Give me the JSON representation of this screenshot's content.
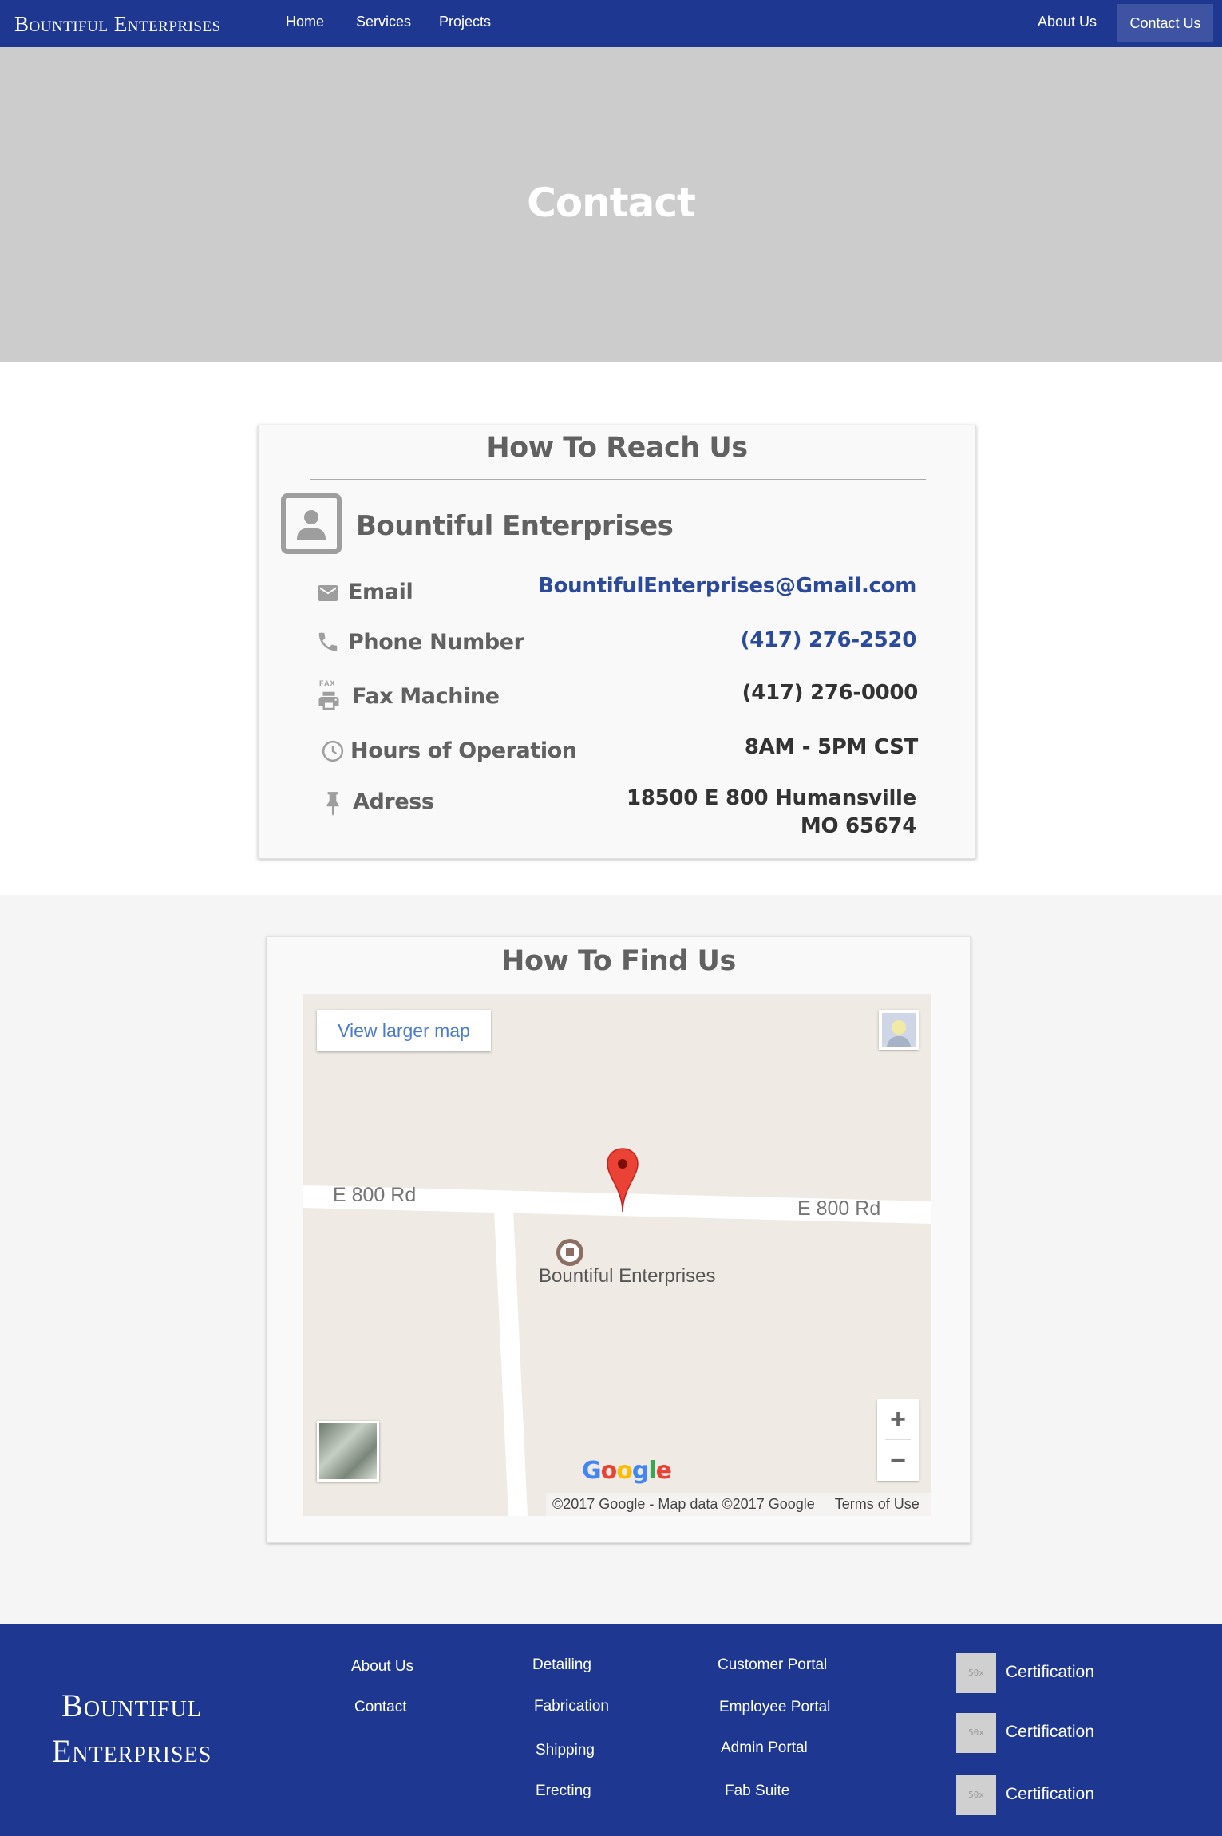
{
  "navbar": {
    "brand": "Bountiful Enterprises",
    "links": [
      "Home",
      "Services",
      "Projects"
    ],
    "about": "About Us",
    "contact": "Contact Us"
  },
  "hero": {
    "title": "Contact"
  },
  "reach": {
    "heading": "How To Reach Us",
    "company": "Bountiful Enterprises",
    "rows": [
      {
        "icon": "envelope-icon",
        "label": "Email",
        "value": "BountifulEnterprises@Gmail.com"
      },
      {
        "icon": "phone-icon",
        "label": "Phone Number",
        "value": "(417) 276-2520"
      },
      {
        "icon": "fax-icon",
        "label": "Fax Machine",
        "value": "(417) 276-0000"
      },
      {
        "icon": "clock-icon",
        "label": "Hours of Operation",
        "value": "8AM - 5PM CST"
      },
      {
        "icon": "pin-icon",
        "label": "Adress",
        "value_line1": "18500 E 800 Humansville",
        "value_line2": "MO 65674"
      }
    ],
    "fax_icon_text": "FAX"
  },
  "find": {
    "heading": "How To Find Us",
    "map": {
      "view_larger": "View larger map",
      "road_left": "E 800 Rd",
      "road_right": "E 800 Rd",
      "place": "Bountiful Enterprises",
      "zoom_in": "+",
      "zoom_out": "−",
      "google_letters": [
        "G",
        "o",
        "o",
        "g",
        "l",
        "e"
      ],
      "google_colors": [
        "#4285f4",
        "#ea4335",
        "#fbbc05",
        "#4285f4",
        "#34a853",
        "#ea4335"
      ],
      "copyright": "©2017 Google - Map data ©2017 Google",
      "terms": "Terms of Use"
    }
  },
  "footer": {
    "brand_line1": "Bountiful",
    "brand_line2": "Enterprises",
    "col1": [
      "About Us",
      "Contact"
    ],
    "col2": [
      "Detailing",
      "Fabrication",
      "Shipping",
      "Erecting"
    ],
    "col3": [
      "Customer Portal",
      "Employee Portal",
      "Admin Portal",
      "Fab Suite"
    ],
    "certs": [
      {
        "thumb": "50x",
        "label": "Certification"
      },
      {
        "thumb": "50x",
        "label": "Certification"
      },
      {
        "thumb": "50x",
        "label": "Certification"
      }
    ]
  },
  "colors": {
    "brand_blue": "#1e3791",
    "link_blue": "#2c4a9c",
    "hero_gray": "#cccccc",
    "pin_red": "#ea4335"
  }
}
